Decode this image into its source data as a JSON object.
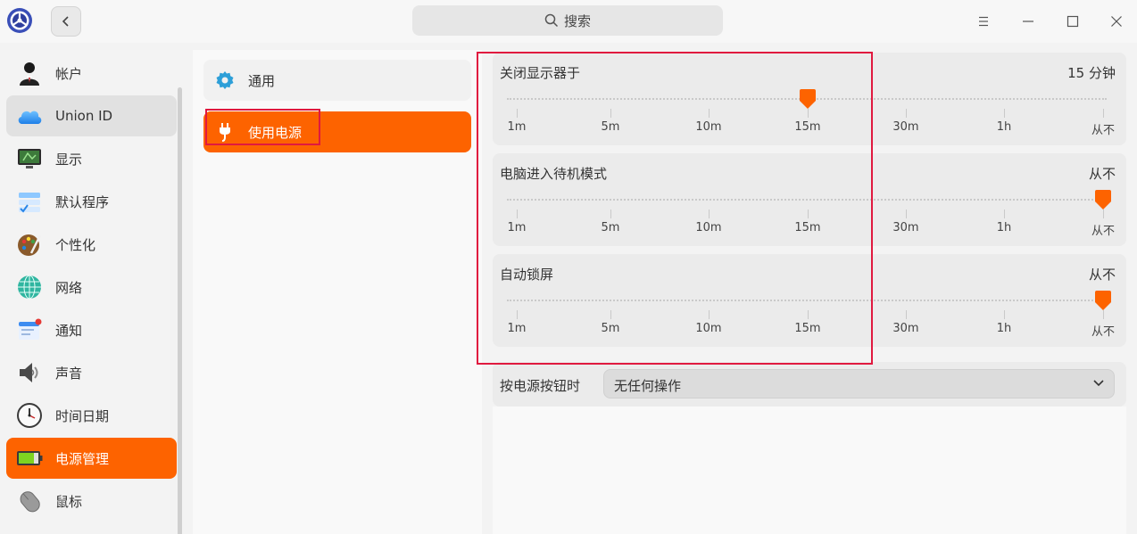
{
  "search": {
    "label": "搜索"
  },
  "sidebar": {
    "items": [
      {
        "label": "帐户",
        "icon": "user-account-icon"
      },
      {
        "label": "Union ID",
        "icon": "cloud-icon"
      },
      {
        "label": "显示",
        "icon": "monitor-icon"
      },
      {
        "label": "默认程序",
        "icon": "default-apps-icon"
      },
      {
        "label": "个性化",
        "icon": "palette-icon"
      },
      {
        "label": "网络",
        "icon": "network-globe-icon"
      },
      {
        "label": "通知",
        "icon": "notification-icon"
      },
      {
        "label": "声音",
        "icon": "speaker-icon"
      },
      {
        "label": "时间日期",
        "icon": "clock-icon"
      },
      {
        "label": "电源管理",
        "icon": "battery-icon"
      },
      {
        "label": "鼠标",
        "icon": "mouse-icon"
      }
    ],
    "hover_index": 1,
    "active_index": 9
  },
  "subnav": {
    "items": [
      {
        "label": "通用",
        "icon": "gear-icon"
      },
      {
        "label": "使用电源",
        "icon": "power-plug-icon"
      }
    ]
  },
  "settings": [
    {
      "title": "关闭显示器于",
      "value": "15 分钟",
      "selected_tick": 3
    },
    {
      "title": "电脑进入待机模式",
      "value": "从不",
      "selected_tick": 6
    },
    {
      "title": "自动锁屏",
      "value": "从不",
      "selected_tick": 6
    }
  ],
  "ticks": [
    "1m",
    "5m",
    "10m",
    "15m",
    "30m",
    "1h",
    "从不"
  ],
  "power_button": {
    "label": "按电源按钮时",
    "selected": "无任何操作"
  },
  "colors": {
    "accent": "#fd6300",
    "highlight_box": "#e0193f"
  }
}
